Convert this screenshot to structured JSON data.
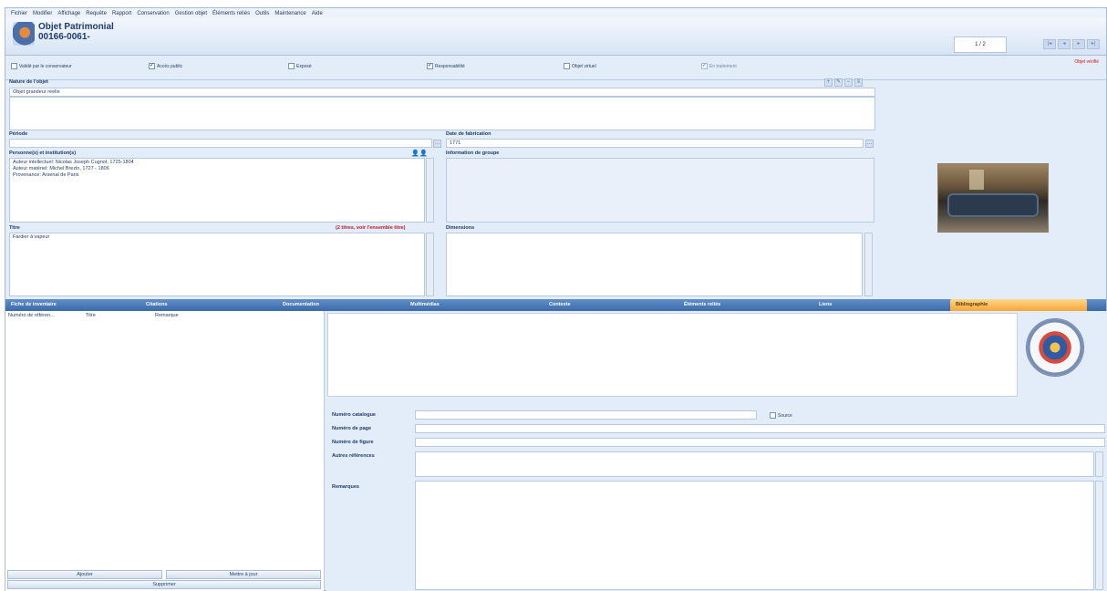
{
  "menu": [
    "Fichier",
    "Modifier",
    "Affichage",
    "Requête",
    "Rapport",
    "Conservation",
    "Gestion objet",
    "Éléments reliés",
    "Outils",
    "Maintenance",
    "Aide"
  ],
  "header": {
    "title": "Objet Patrimonial",
    "number": "00166-0061-",
    "record_counter": "1 / 2"
  },
  "checkboxes": [
    {
      "label": "Validé par le conservateur",
      "checked": false
    },
    {
      "label": "Accès public",
      "checked": true
    },
    {
      "label": "Exposé",
      "checked": false
    },
    {
      "label": "Responsabilité",
      "checked": true
    },
    {
      "label": "Objet virtuel",
      "checked": false
    },
    {
      "label": "En traitement",
      "checked": true
    }
  ],
  "warning": "Objet vérifié",
  "form": {
    "nature_label": "Nature de l'objet",
    "nature_value": "Objet grandeur réelle",
    "periode_label": "Période",
    "periode_value": "",
    "date_label": "Date de fabrication",
    "date_value": "1771",
    "personnes_label": "Personne(s) et institution(s)",
    "personnes_value": "Auteur intellectuel: Nicolas Joseph Cugnot, 1725-1804\nAuteur matériel: Michel Brezin, 1727 - 1806\nProvenance: Arsenal de Paris",
    "info_groupe_label": "Information de groupe",
    "titre_label": "Titre",
    "titre_note": "(2 titres, voir l'ensemble titre)",
    "titre_value": "Fardier à vapeur",
    "dimensions_label": "Dimensions"
  },
  "tabs": [
    "Fiche de inventaire",
    "Citations",
    "Documentation",
    "Multimédias",
    "Contexte",
    "Éléments reliés",
    "Liens",
    "Bibliographie"
  ],
  "active_tab": "Bibliographie",
  "list_columns": [
    "Numéro de référen...",
    "Titre",
    "Remarque"
  ],
  "buttons": {
    "add": "Ajouter",
    "update": "Mettre à jour",
    "delete": "Supprimer"
  },
  "biblio": {
    "catalog_label": "Numéro catalogue",
    "catalog_value": "",
    "source_label": "Source",
    "page_label": "Numéro de page",
    "figure_label": "Numéro de figure",
    "other_refs_label": "Autres références",
    "remarks_label": "Remarques"
  }
}
